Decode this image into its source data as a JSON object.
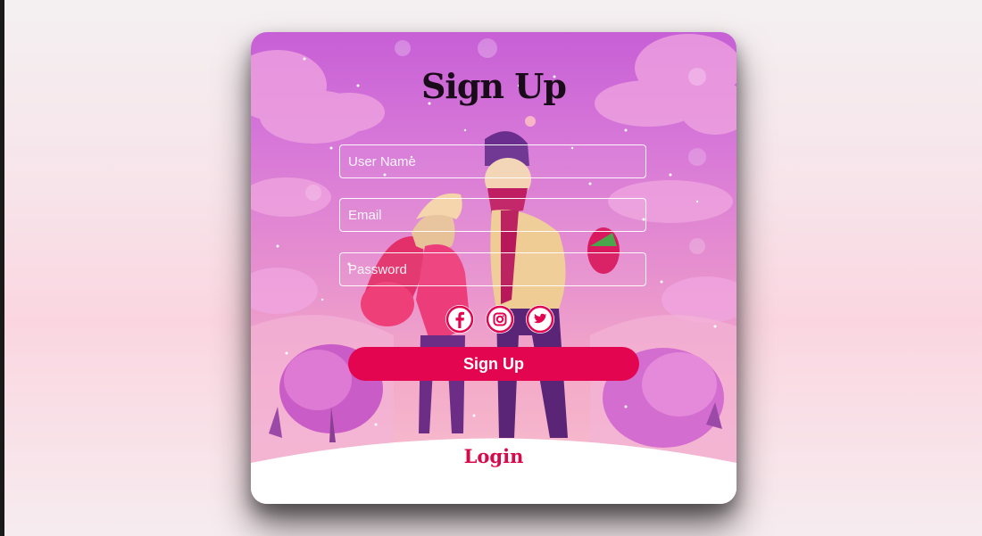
{
  "form": {
    "title": "Sign Up",
    "fields": [
      {
        "placeholder": "User Name",
        "value": ""
      },
      {
        "placeholder": "Email",
        "value": ""
      },
      {
        "placeholder": "Password",
        "value": ""
      }
    ],
    "social": [
      "facebook-icon",
      "instagram-icon",
      "twitter-icon"
    ],
    "submit_label": "Sign Up"
  },
  "login": {
    "label": "Login"
  },
  "colors": {
    "accent": "#e3054f",
    "login_text": "#d8094a",
    "title_text": "#1a0b1b",
    "card_top": "#c75fd6",
    "card_bottom": "#f8c3cf"
  }
}
